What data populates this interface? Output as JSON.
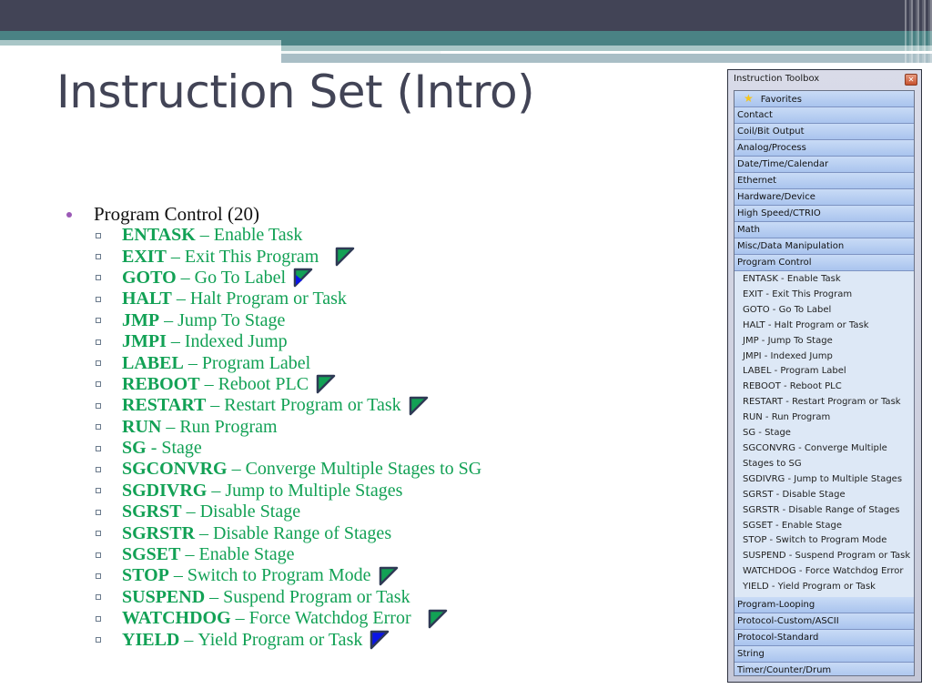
{
  "slide": {
    "title": "Instruction Set (Intro)",
    "bullet": "Program Control (20)",
    "instructions": [
      {
        "code": "ENTASK",
        "sep": " – ",
        "desc": "Enable Task",
        "flag": null
      },
      {
        "code": "EXIT",
        "sep": " – ",
        "desc": "Exit This Program",
        "flag": "green"
      },
      {
        "code": "GOTO",
        "sep": " – ",
        "desc": "Go To Label",
        "flag": "blue-green"
      },
      {
        "code": "HALT",
        "sep": " – ",
        "desc": "Halt Program or Task",
        "flag": null
      },
      {
        "code": "JMP",
        "sep": " – ",
        "desc": "Jump To Stage",
        "flag": null
      },
      {
        "code": "JMPI",
        "sep": " – ",
        "desc": "Indexed Jump",
        "flag": null
      },
      {
        "code": "LABEL",
        "sep": " – ",
        "desc": "Program Label",
        "flag": null
      },
      {
        "code": "REBOOT",
        "sep": " – ",
        "desc": "Reboot PLC",
        "flag": "green"
      },
      {
        "code": "RESTART",
        "sep": " – ",
        "desc": "Restart Program or Task",
        "flag": "green"
      },
      {
        "code": "RUN",
        "sep": " – ",
        "desc": "Run Program",
        "flag": null
      },
      {
        "code": "SG",
        "sep": " - ",
        "desc": "Stage",
        "flag": null
      },
      {
        "code": "SGCONVRG",
        "sep": " – ",
        "desc": "Converge Multiple Stages to SG",
        "flag": null
      },
      {
        "code": "SGDIVRG",
        "sep": " – ",
        "desc": "Jump to Multiple Stages",
        "flag": null
      },
      {
        "code": "SGRST",
        "sep": " – ",
        "desc": "Disable Stage",
        "flag": null
      },
      {
        "code": "SGRSTR",
        "sep": " – ",
        "desc": "Disable Range of Stages",
        "flag": null
      },
      {
        "code": "SGSET",
        "sep": " – ",
        "desc": "Enable Stage",
        "flag": null
      },
      {
        "code": "STOP",
        "sep": " – ",
        "desc": "Switch to Program Mode",
        "flag": "green"
      },
      {
        "code": "SUSPEND",
        "sep": " – ",
        "desc": "Suspend Program or Task",
        "flag": null
      },
      {
        "code": "WATCHDOG",
        "sep": " – ",
        "desc": "Force Watchdog Error",
        "flag": "green"
      },
      {
        "code": "YIELD",
        "sep": " – ",
        "desc": "Yield Program or Task",
        "flag": "blue"
      }
    ]
  },
  "colors": {
    "instruction_text": "#12a155",
    "flag_green": "#12a155",
    "flag_blue": "#0a14e6",
    "flag_border": "#2f3a55",
    "header_dark": "#424456",
    "header_teal": "#4a8284"
  },
  "toolbox": {
    "title": "Instruction Toolbox",
    "close_icon": "close-icon",
    "favorites": {
      "label": "Favorites",
      "icon": "star-icon"
    },
    "categories_before": [
      "Contact",
      "Coil/Bit Output",
      "Analog/Process",
      "Date/Time/Calendar",
      "Ethernet",
      "Hardware/Device",
      "High Speed/CTRIO",
      "Math",
      "Misc/Data Manipulation",
      "Program Control"
    ],
    "expanded_items": [
      "ENTASK - Enable Task",
      "EXIT - Exit This Program",
      "GOTO - Go To Label",
      "HALT - Halt Program or Task",
      "JMP - Jump To Stage",
      "JMPI - Indexed Jump",
      "LABEL - Program Label",
      "REBOOT - Reboot PLC",
      "RESTART - Restart Program or Task",
      "RUN - Run Program",
      "SG - Stage",
      "SGCONVRG - Converge Multiple Stages to SG",
      "SGDIVRG - Jump to Multiple Stages",
      "SGRST - Disable Stage",
      "SGRSTR - Disable Range of Stages",
      "SGSET - Enable Stage",
      "STOP - Switch to Program Mode",
      "SUSPEND - Suspend Program or Task",
      "WATCHDOG - Force Watchdog Error",
      "YIELD - Yield Program or Task"
    ],
    "categories_after": [
      "Program-Looping",
      "Protocol-Custom/ASCII",
      "Protocol-Standard",
      "String",
      "Timer/Counter/Drum"
    ]
  }
}
